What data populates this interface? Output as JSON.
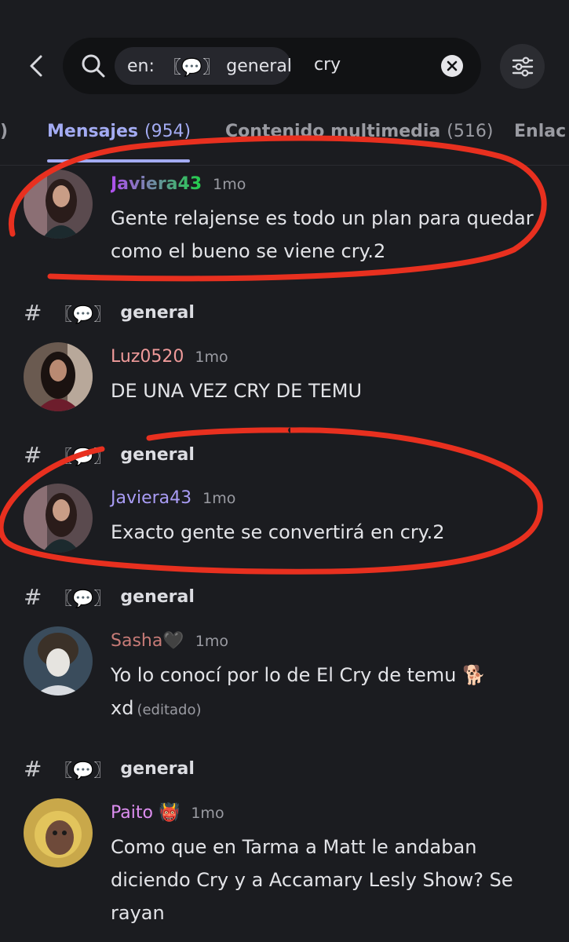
{
  "search": {
    "chip_prefix": "en:",
    "chip_channel_emoji": "〖💬〗",
    "chip_channel": "general",
    "query": "cry"
  },
  "tabs": [
    {
      "label": "Mensajes",
      "count": "(954)"
    },
    {
      "label": "Contenido multimedia",
      "count": "(516)"
    },
    {
      "label": "Enlac"
    }
  ],
  "channel_label": {
    "hash": "#",
    "emoji": "〖💬〗",
    "name": "general"
  },
  "messages": [
    {
      "author": "Javiera43",
      "time": "1mo",
      "text": "Gente relajense es todo un plan para quedar como el bueno se viene cry.2"
    },
    {
      "author": "Luz0520",
      "time": "1mo",
      "text": "DE UNA VEZ CRY DE TEMU"
    },
    {
      "author": "Javiera43",
      "time": "1mo",
      "text": "Exacto gente se convertirá en cry.2"
    },
    {
      "author": "Sasha🖤",
      "time": "1mo",
      "text": "Yo lo conocí  por lo de  El Cry de temu 🐕",
      "text2": "xd",
      "edited": "(editado)"
    },
    {
      "author": "Paito 👹",
      "time": "1mo",
      "text": "Como que en Tarma a Matt le andaban diciendo Cry y a Accamary Lesly Show? Se rayan"
    }
  ],
  "colors": {
    "background": "#1b1c20",
    "accent_tab": "#a3abf2",
    "annotation_red": "#e8301f",
    "author_javiera_gradient": [
      "#b14ff0",
      "#21d04a"
    ],
    "author_luz": "#ef9a9a",
    "author_javiera2": "#a99cf5",
    "author_sasha": "#c77b77",
    "author_paito": "#dd8ef0"
  }
}
